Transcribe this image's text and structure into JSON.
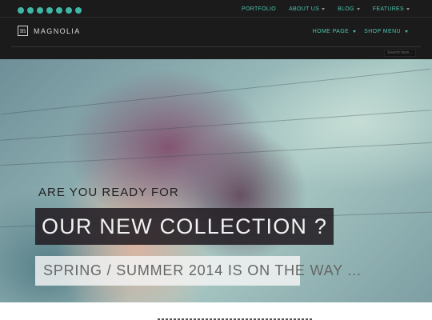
{
  "topbar": {
    "social_icons": [
      "facebook-icon",
      "twitter-icon",
      "google-plus-icon",
      "vimeo-icon",
      "pinterest-icon",
      "flickr-icon",
      "skype-icon"
    ],
    "nav": [
      {
        "label": "PORTFOLIO"
      },
      {
        "label": "ABOUT US"
      },
      {
        "label": "BLOG"
      },
      {
        "label": "FEATURES"
      }
    ]
  },
  "header": {
    "logo_mark": "m",
    "logo_text": "MAGNOLIA",
    "nav": [
      {
        "label": "HOME PAGE"
      },
      {
        "label": "SHOP MENU"
      }
    ],
    "search_placeholder": "Search here..."
  },
  "hero": {
    "tagline": "ARE YOU READY FOR",
    "headline": "OUR NEW COLLECTION ?",
    "subline": "SPRING / SUMMER 2014 IS ON THE WAY ..."
  },
  "colors": {
    "accent": "#4dc2b0",
    "bar_background": "#1b1b1b"
  }
}
